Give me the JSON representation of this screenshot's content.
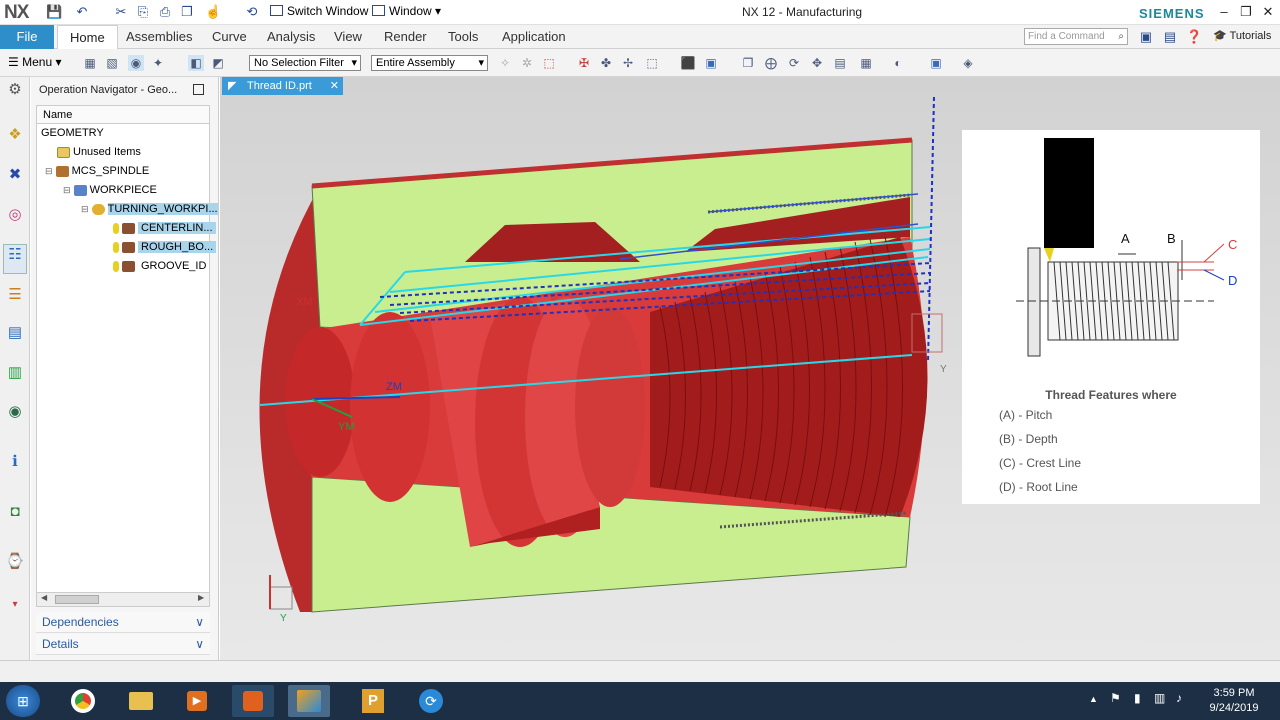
{
  "app": {
    "logo": "NX",
    "title": "NX 12 - Manufacturing",
    "brand": "SIEMENS",
    "switch_window": "Switch Window",
    "window_menu": "Window",
    "accent": "#2d8ec9"
  },
  "ribbon": {
    "file": "File",
    "tabs": [
      "Home",
      "Assemblies",
      "Curve",
      "Analysis",
      "View",
      "Render",
      "Tools",
      "Application"
    ],
    "find_placeholder": "Find a Command",
    "tutorials": "Tutorials"
  },
  "toolbar": {
    "menu": "Menu",
    "selection_filter": "No Selection Filter",
    "assembly_scope": "Entire Assembly"
  },
  "navigator": {
    "title": "Operation Navigator - Geo...",
    "column": "Name",
    "tree": [
      {
        "label": "GEOMETRY"
      },
      {
        "label": "Unused Items"
      },
      {
        "label": "MCS_SPINDLE"
      },
      {
        "label": "WORKPIECE"
      },
      {
        "label": "TURNING_WORKPI..."
      },
      {
        "label": "CENTERLIN..."
      },
      {
        "label": "ROUGH_BO..."
      },
      {
        "label": "GROOVE_ID"
      }
    ],
    "dependencies": "Dependencies",
    "details": "Details"
  },
  "viewport": {
    "tab": "Thread ID.prt",
    "axis_labels": {
      "zm": "ZM",
      "xm": "XM",
      "ym": "YM",
      "y": "Y"
    }
  },
  "thread_card": {
    "labels": {
      "a": "A",
      "b": "B",
      "c": "C",
      "d": "D"
    },
    "title": "Thread Features where",
    "features": [
      "(A)  -  Pitch",
      "(B)  -  Depth",
      "(C)  -  Crest Line",
      "(D)  -  Root Line"
    ]
  },
  "taskbar": {
    "time": "3:59 PM",
    "date": "9/24/2019"
  }
}
